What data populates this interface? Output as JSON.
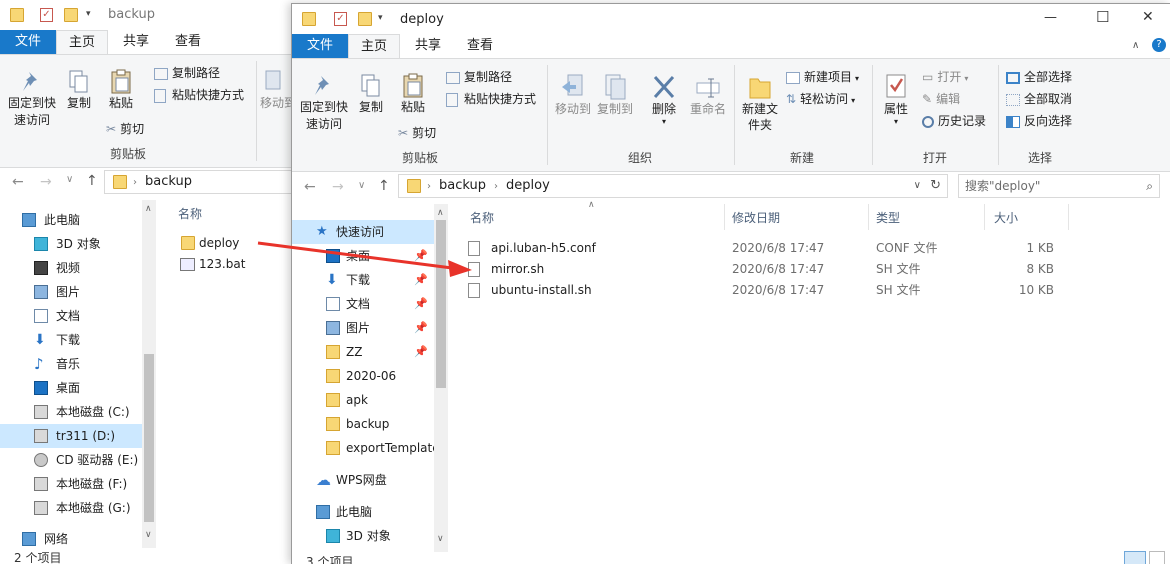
{
  "back_window": {
    "title": "backup",
    "tabs": [
      "文件",
      "主页",
      "共享",
      "查看"
    ],
    "ribbon": {
      "pin_label": "固定到快速访问",
      "copy_label": "复制",
      "paste_label": "粘贴",
      "copy_path": "复制路径",
      "paste_shortcut": "粘贴快捷方式",
      "cut": "剪切",
      "move_to": "移动到",
      "group_clipboard": "剪贴板"
    },
    "address": {
      "crumb": "backup"
    },
    "nav": [
      {
        "label": "此电脑",
        "icon": "computer-icon"
      },
      {
        "label": "3D 对象",
        "icon": "3d-objects-icon"
      },
      {
        "label": "视频",
        "icon": "video-icon"
      },
      {
        "label": "图片",
        "icon": "pictures-icon"
      },
      {
        "label": "文档",
        "icon": "documents-icon"
      },
      {
        "label": "下载",
        "icon": "download-icon"
      },
      {
        "label": "音乐",
        "icon": "music-icon"
      },
      {
        "label": "桌面",
        "icon": "desktop-icon"
      },
      {
        "label": "本地磁盘 (C:)",
        "icon": "drive-icon"
      },
      {
        "label": "tr311 (D:)",
        "icon": "drive-icon"
      },
      {
        "label": "CD 驱动器 (E:)",
        "icon": "cd-drive-icon"
      },
      {
        "label": "本地磁盘 (F:)",
        "icon": "drive-icon"
      },
      {
        "label": "本地磁盘 (G:)",
        "icon": "drive-icon"
      },
      {
        "label": "网络",
        "icon": "network-icon"
      }
    ],
    "column_name": "名称",
    "files": [
      {
        "name": "deploy",
        "icon": "folder-icon"
      },
      {
        "name": "123.bat",
        "icon": "bat-file-icon"
      }
    ],
    "status": "2 个项目"
  },
  "front_window": {
    "title": "deploy",
    "tabs": [
      "文件",
      "主页",
      "共享",
      "查看"
    ],
    "window_controls": {
      "minimize": "—",
      "maximize": "☐",
      "close": "✕"
    },
    "ribbon": {
      "pin_label": "固定到快速访问",
      "copy_label": "复制",
      "paste_label": "粘贴",
      "copy_path": "复制路径",
      "paste_shortcut": "粘贴快捷方式",
      "cut": "剪切",
      "move_to": "移动到",
      "copy_to": "复制到",
      "delete": "删除",
      "rename": "重命名",
      "new_folder": "新建文件夹",
      "new_item": "新建项目",
      "easy_access": "轻松访问",
      "properties": "属性",
      "open": "打开",
      "edit": "编辑",
      "history": "历史记录",
      "select_all": "全部选择",
      "select_none": "全部取消",
      "invert_select": "反向选择",
      "group_clipboard": "剪贴板",
      "group_organize": "组织",
      "group_new": "新建",
      "group_open": "打开",
      "group_select": "选择"
    },
    "address": {
      "crumb1": "backup",
      "crumb2": "deploy"
    },
    "search_placeholder": "搜索\"deploy\"",
    "nav": [
      {
        "label": "快速访问",
        "icon": "quick-access-star-icon",
        "pinned": false
      },
      {
        "label": "桌面",
        "icon": "desktop-icon",
        "pinned": true
      },
      {
        "label": "下载",
        "icon": "download-icon",
        "pinned": true
      },
      {
        "label": "文档",
        "icon": "documents-icon",
        "pinned": true
      },
      {
        "label": "图片",
        "icon": "pictures-icon",
        "pinned": true
      },
      {
        "label": "ZZ",
        "icon": "folder-icon",
        "pinned": true
      },
      {
        "label": "2020-06",
        "icon": "folder-icon",
        "pinned": false
      },
      {
        "label": "apk",
        "icon": "folder-icon",
        "pinned": false
      },
      {
        "label": "backup",
        "icon": "folder-icon",
        "pinned": false
      },
      {
        "label": "exportTemplate",
        "icon": "folder-icon",
        "pinned": false
      },
      {
        "label": "WPS网盘",
        "icon": "wps-cloud-icon",
        "pinned": false
      },
      {
        "label": "此电脑",
        "icon": "computer-icon",
        "pinned": false
      },
      {
        "label": "3D 对象",
        "icon": "3d-objects-icon",
        "pinned": false
      }
    ],
    "columns": {
      "name": "名称",
      "modified": "修改日期",
      "type": "类型",
      "size": "大小"
    },
    "files": [
      {
        "name": "api.luban-h5.conf",
        "modified": "2020/6/8 17:47",
        "type": "CONF 文件",
        "size": "1 KB"
      },
      {
        "name": "mirror.sh",
        "modified": "2020/6/8 17:47",
        "type": "SH 文件",
        "size": "8 KB"
      },
      {
        "name": "ubuntu-install.sh",
        "modified": "2020/6/8 17:47",
        "type": "SH 文件",
        "size": "10 KB"
      }
    ],
    "status": "3 个项目"
  },
  "colors": {
    "accent": "#1979ca",
    "selection": "#cce8ff",
    "folder": "#f8d775",
    "arrow": "#e8332a"
  }
}
